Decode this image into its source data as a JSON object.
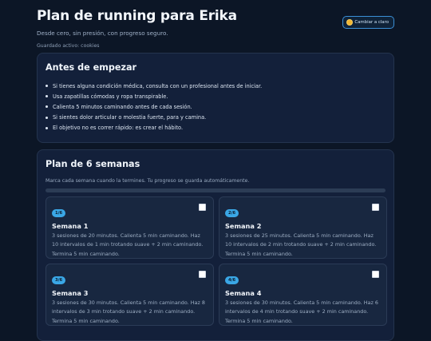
{
  "header": {
    "title": "Plan de running para Erika",
    "subtitle": "Desde cero, sin presión, con progreso seguro.",
    "saved": "Guardado activo: cookies",
    "theme_button": "Cambiar a claro",
    "theme_icon": "sun-icon"
  },
  "intro": {
    "title": "Antes de empezar",
    "items": [
      "Si tienes alguna condición médica, consulta con un profesional antes de iniciar.",
      "Usa zapatillas cómodas y ropa transpirable.",
      "Calienta 5 minutos caminando antes de cada sesión.",
      "Si sientes dolor articular o molestia fuerte, para y camina.",
      "El objetivo no es correr rápido: es crear el hábito."
    ]
  },
  "plan": {
    "title": "Plan de 6 semanas",
    "subtitle": "Marca cada semana cuando la termines. Tu progreso se guarda automáticamente.",
    "progress": 0,
    "weeks": [
      {
        "badge": "1/6",
        "title": "Semana 1",
        "text": "3 sesiones de 20 minutos. Calienta 5 min caminando. Haz 10 intervalos de 1 min trotando suave + 2 min caminando. Termina 5 min caminando.",
        "checked": false
      },
      {
        "badge": "2/6",
        "title": "Semana 2",
        "text": "3 sesiones de 25 minutos. Calienta 5 min caminando. Haz 10 intervalos de 2 min trotando suave + 2 min caminando. Termina 5 min caminando.",
        "checked": false
      },
      {
        "badge": "3/6",
        "title": "Semana 3",
        "text": "3 sesiones de 30 minutos. Calienta 5 min caminando. Haz 8 intervalos de 3 min trotando suave + 2 min caminando. Termina 5 min caminando.",
        "checked": false
      },
      {
        "badge": "4/6",
        "title": "Semana 4",
        "text": "3 sesiones de 30 minutos. Calienta 5 min caminando. Haz 6 intervalos de 4 min trotando suave + 2 min caminando. Termina 5 min caminando.",
        "checked": false
      }
    ]
  },
  "colors": {
    "background": "#0c1626",
    "card": "#13203a",
    "accent": "#3aa7e6"
  }
}
